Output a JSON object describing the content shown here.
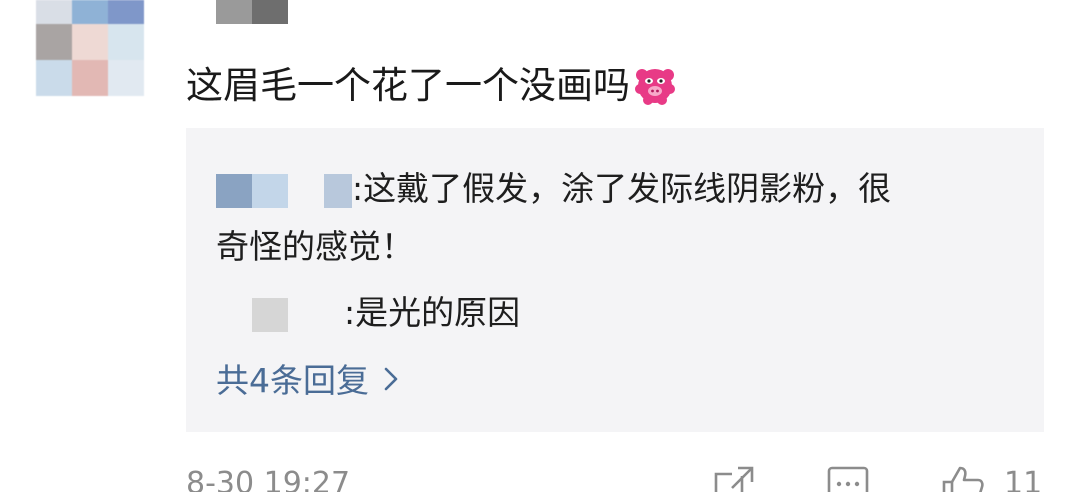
{
  "comment": {
    "text": "这眉毛一个花了一个没画吗",
    "emoji_icon": "angry-pig-face-emoji"
  },
  "replies": [
    {
      "text": ":这戴了假发，涂了发际线阴影粉，很"
    },
    {
      "text": "奇怪的感觉！"
    },
    {
      "text": ":是光的原因"
    }
  ],
  "more_replies_label": "共4条回复",
  "footer": {
    "timestamp": "8-30 19:27",
    "like_count": "11",
    "icons": [
      "share-icon",
      "comment-icon",
      "like-icon"
    ]
  },
  "colors": {
    "link": "#4a6c96",
    "reply_bg": "#f4f4f6",
    "muted": "#8c8c8c"
  }
}
